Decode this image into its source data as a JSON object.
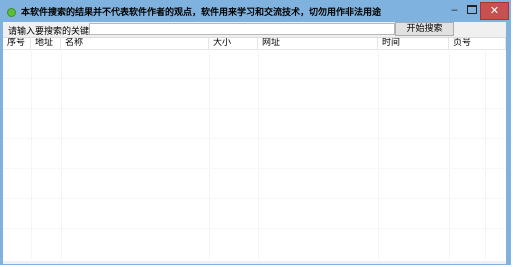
{
  "window": {
    "title": "本软件搜索的结果并不代表软件作者的观点，软件用来学习和交流技术，切勿用作非法用途",
    "minimize_glyph": "‒",
    "close_glyph": "✕"
  },
  "search": {
    "prompt": "请输入要搜索的关键字",
    "value": "",
    "placeholder": "",
    "button_label": "开始搜索"
  },
  "columns": [
    "序号",
    "地址",
    "名称",
    "大小",
    "网址",
    "时间",
    "页号"
  ],
  "rows": []
}
